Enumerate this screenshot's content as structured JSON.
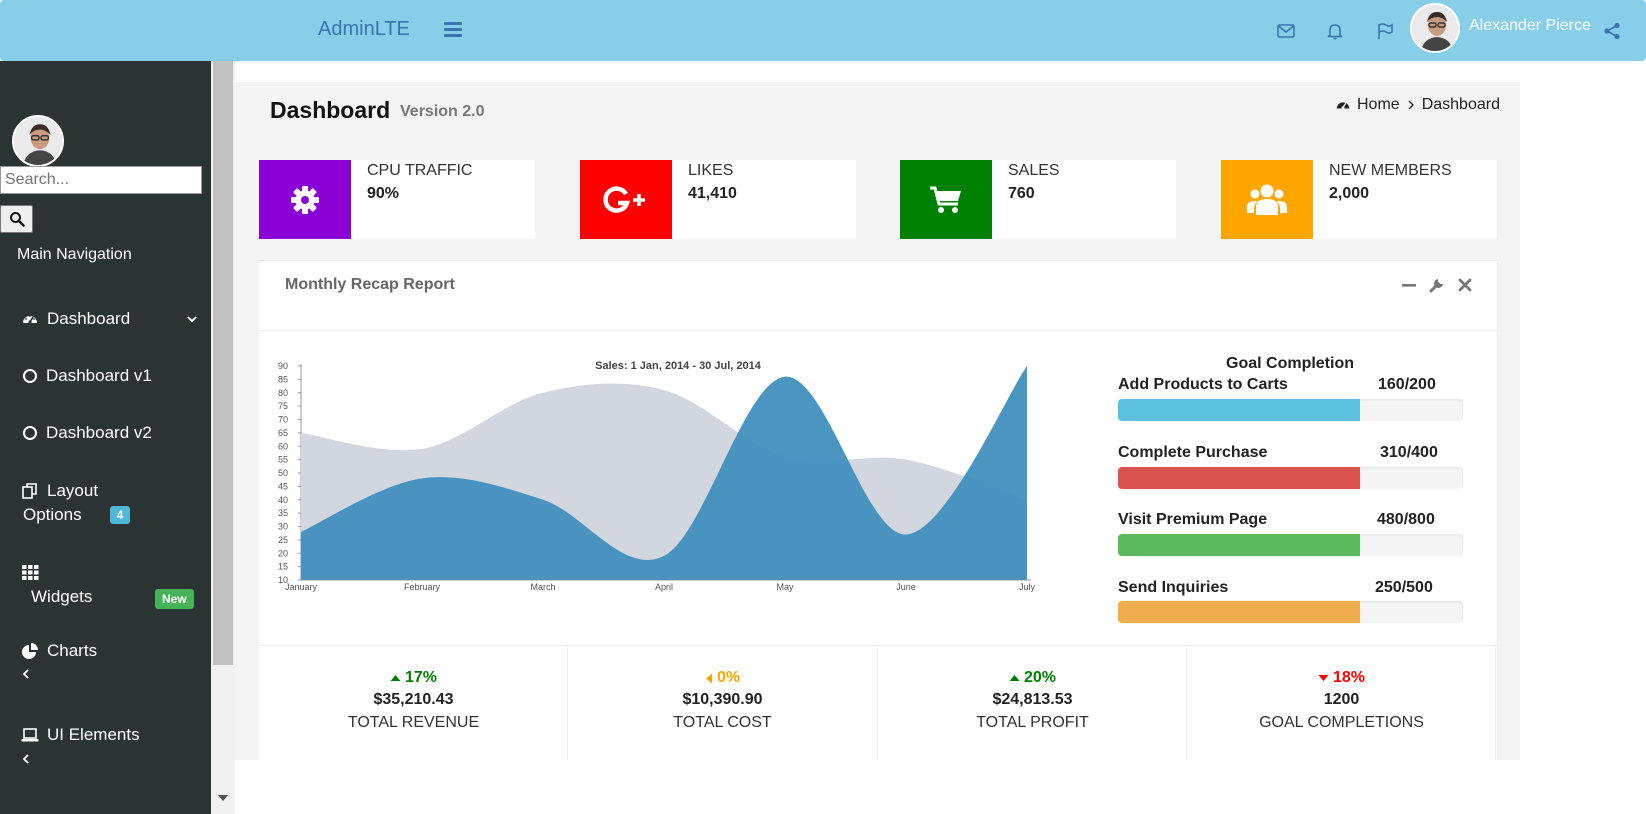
{
  "header": {
    "brand": "AdminLTE",
    "user_name": "Alexander Pierce"
  },
  "sidebar": {
    "search_placeholder": "Search...",
    "nav_header": "Main Navigation",
    "dashboard": "Dashboard",
    "dashboard_v1": "Dashboard v1",
    "dashboard_v2": "Dashboard v2",
    "layout_line1": "Layout",
    "layout_line2": "Options",
    "layout_badge": "4",
    "widgets": "Widgets",
    "widgets_badge": "New",
    "charts": "Charts",
    "ui_elements": "UI Elements"
  },
  "page": {
    "title": "Dashboard",
    "subtitle": "Version 2.0",
    "breadcrumb_home": "Home",
    "breadcrumb_current": "Dashboard"
  },
  "info_boxes": [
    {
      "label": "CPU TRAFFIC",
      "value": "90%",
      "color": "#8b00d4",
      "icon": "gear-icon"
    },
    {
      "label": "LIKES",
      "value": "41,410",
      "color": "#ff0000",
      "icon": "google-plus-icon"
    },
    {
      "label": "SALES",
      "value": "760",
      "color": "#008000",
      "icon": "shopping-cart-icon"
    },
    {
      "label": "NEW MEMBERS",
      "value": "2,000",
      "color": "#ffa500",
      "icon": "users-icon"
    }
  ],
  "report": {
    "title": "Monthly Recap Report",
    "goal_title": "Goal Completion",
    "goals": [
      {
        "label": "Add Products to Carts",
        "value": "160/200",
        "color": "#5bc0de",
        "progress": 0.7
      },
      {
        "label": "Complete Purchase",
        "value": "310/400",
        "color": "#d9534f",
        "progress": 0.7
      },
      {
        "label": "Visit Premium Page",
        "value": "480/800",
        "color": "#5cb85c",
        "progress": 0.7
      },
      {
        "label": "Send Inquiries",
        "value": "250/500",
        "color": "#f0ad4e",
        "progress": 0.7
      }
    ]
  },
  "descriptions": [
    {
      "pct": "17%",
      "direction": "up",
      "color": "#008000",
      "amount": "$35,210.43",
      "label": "TOTAL REVENUE"
    },
    {
      "pct": "0%",
      "direction": "left",
      "color": "#ffa500",
      "amount": "$10,390.90",
      "label": "TOTAL COST"
    },
    {
      "pct": "20%",
      "direction": "up",
      "color": "#008000",
      "amount": "$24,813.53",
      "label": "TOTAL PROFIT"
    },
    {
      "pct": "18%",
      "direction": "down",
      "color": "#ff0000",
      "amount": "1200",
      "label": "GOAL COMPLETIONS"
    }
  ],
  "chart_data": {
    "type": "area",
    "title": "Sales: 1 Jan, 2014 - 30 Jul, 2014",
    "categories": [
      "January",
      "February",
      "March",
      "April",
      "May",
      "June",
      "July"
    ],
    "yticks": [
      10,
      15,
      20,
      25,
      30,
      35,
      40,
      45,
      50,
      55,
      60,
      65,
      70,
      75,
      80,
      85,
      90
    ],
    "ylim": [
      10,
      90
    ],
    "series": [
      {
        "values": [
          65,
          59,
          80,
          81,
          56,
          55,
          40
        ],
        "color": "#d2d6de"
      },
      {
        "values": [
          28,
          48,
          40,
          19,
          86,
          27,
          90
        ],
        "color": "#3c8dbc"
      }
    ]
  }
}
